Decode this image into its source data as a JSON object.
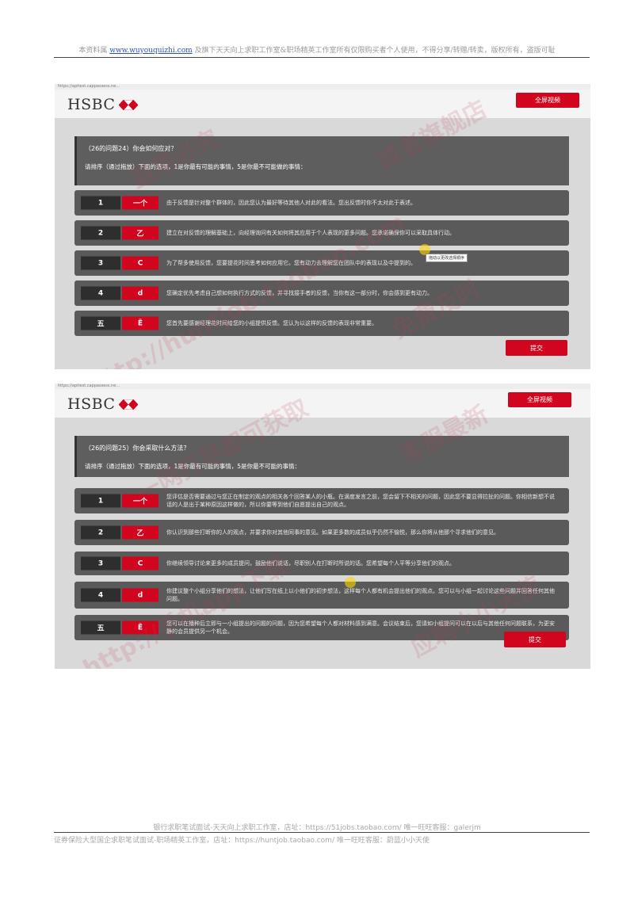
{
  "header": {
    "prefix": "本资料属",
    "link": "www.wuyouquizhi.com",
    "suffix": "及旗下天天向上求职工作室&职场精英工作室所有仅限购买者个人使用，不得分享/转赠/转卖，版权所有，盗版可耻"
  },
  "watermarks": [
    "盗用必究",
    "或者旗舰店",
    "http://huntjob.taobao.com",
    "免费及时",
    "应聘小小天使",
    "http://手机app下载",
    "客服最新",
    "一网打尽即可获取"
  ],
  "screenshots": [
    {
      "url": "https://apitest.cappassess.ne...",
      "logo": "HSBC",
      "top_button": "全屏视频",
      "question_title": "（26的问题24）你会如何应对？",
      "instruction": "请排序（通过拖放）下面的选项，1是你最有可能的事情，5是你最不可能做的事情：",
      "options": [
        {
          "num": "1",
          "rank": "一个",
          "text": "由于反馈是针对整个群体的，因此您认为最好等待其他人对此的看法。您出反馈时你不太对此于表述。"
        },
        {
          "num": "2",
          "rank": "乙",
          "text": "建立在对反馈的理解基础上，向经理询问有关如何将其应用于个人表现的更多问题。您承诺确保你可以采取具体行动。"
        },
        {
          "num": "3",
          "rank": "C",
          "text": "为了帮多使用反馈，您要提花时间思考如何应用它。您有动力去理解您在团队中的表现以及中提到的。"
        },
        {
          "num": "4",
          "rank": "d",
          "text": "您确定优先考虑自己想如何执行方式的反馈，并寻找接手者的反馈，当你有这一部分时，你会感到更有动力。"
        },
        {
          "num": "五",
          "rank": "Ë",
          "text": "您首先要感谢经理花时间给您的小组提供反馈。您认为以这样的反馈的表现非常重要。"
        }
      ],
      "tooltip": "拖动以更改选择顺序",
      "submit": "提交"
    },
    {
      "url": "https://apitest.cappassess.ne...",
      "logo": "HSBC",
      "top_button": "全屏视频",
      "question_title": "（26的问题25）你会采取什么方法？",
      "instruction": "请排序（通过拖放）下面的选项，1是你最有可能的事情，5是你最不可能的事情：",
      "options": [
        {
          "num": "1",
          "rank": "一个",
          "text": "您评估是否需要通过与您正在制定的观点的相关各个回答某人的小瓶。在滴度发言之前，您会留下不相关的问题，因此您不要显得拉扯的问题。你相信新想不说话的人是出于某种原因这样做的，所以你要等到他们自愿提出自己的观点。"
        },
        {
          "num": "2",
          "rank": "乙",
          "text": "你认识到那些打断你的人的观点，并要求你对其他同事的意见。如果更多数的成员似乎仍然不愉悦，那么你将从他那个寻求他们的意见。"
        },
        {
          "num": "3",
          "rank": "C",
          "text": "你继续领导讨论来更多的成员提问，鼓励他们说话，尽职别人在打断时所说的话。您希望每个人平等分享他们的观点。"
        },
        {
          "num": "4",
          "rank": "d",
          "text": "你建议整个小组分享他们的想法，让他们写在纸上以小他们的初步想法，这样每个人都有机会提出他们的观点。您可以与小组一起讨论这些问题并回答任何其他问题。"
        },
        {
          "num": "五",
          "rank": "Ë",
          "text": "您可以在播种后立即与一小组提出的问题的问题，因为您希望每个人都对材料感到满意。会议结束后，您请如小组提问可以在以后与其他任何问题联系，为更安静的会员提供另一个机会。"
        }
      ],
      "submit": "提交"
    }
  ],
  "footer": {
    "line1": "银行求职笔试面试-天天向上求职工作室，店址：https://51jobs.taobao.com/ 唯一旺旺客服：galerjm",
    "line2": "证券保险大型国企求职笔试面试-职场精英工作室，店址：https://huntjob.taobao.com/ 唯一旺旺客服：蔚蓝小小天使"
  }
}
